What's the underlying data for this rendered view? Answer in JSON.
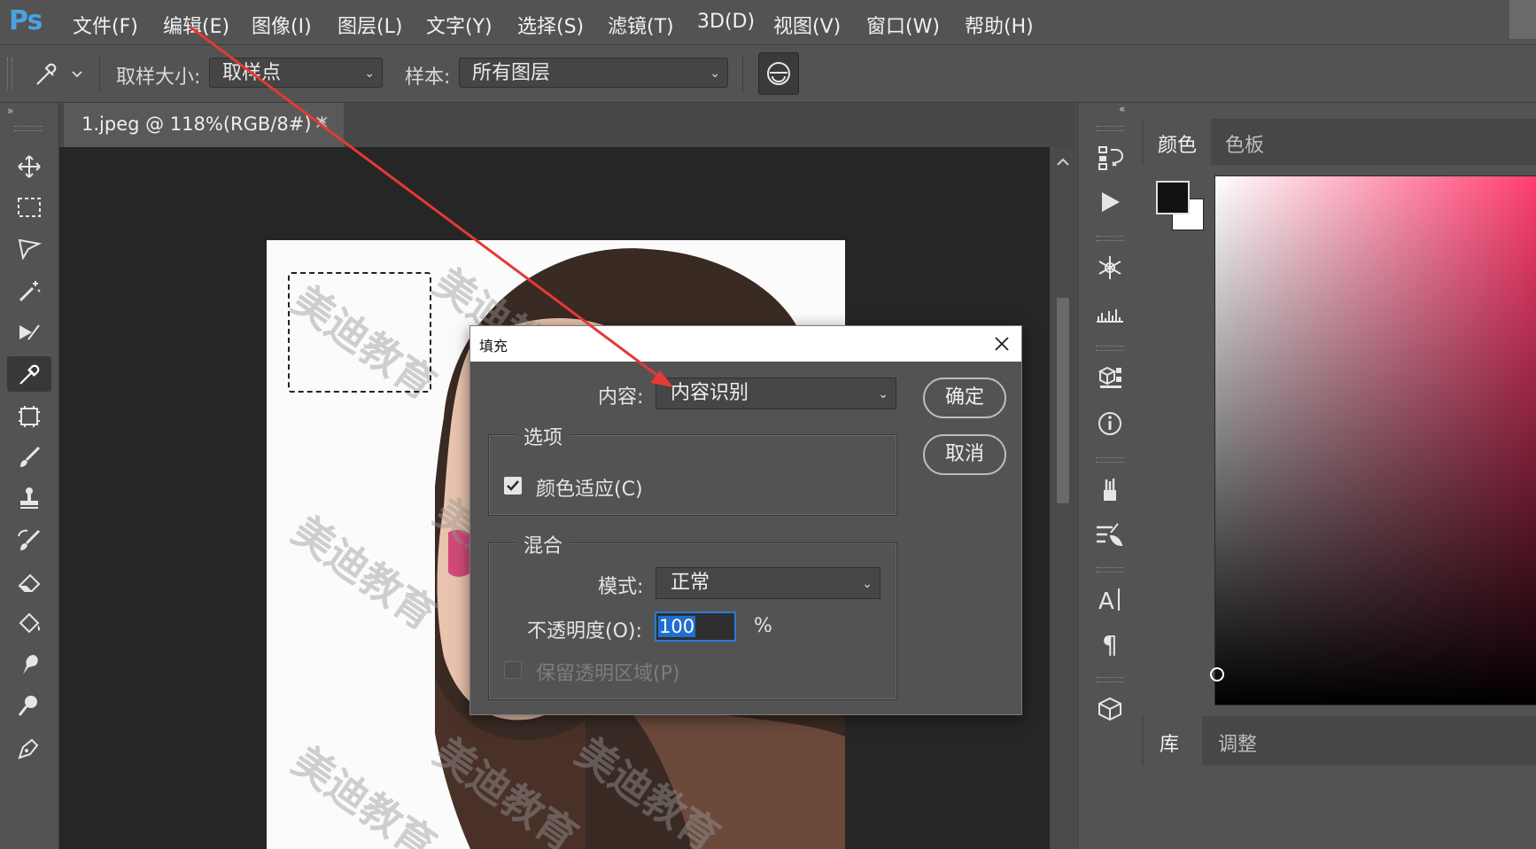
{
  "app": {
    "logo": "Ps",
    "menu": [
      "文件(F)",
      "编辑(E)",
      "图像(I)",
      "图层(L)",
      "文字(Y)",
      "选择(S)",
      "滤镜(T)",
      "3D(D)",
      "视图(V)",
      "窗口(W)",
      "帮助(H)"
    ]
  },
  "options_bar": {
    "sample_size_label": "取样大小:",
    "sample_size_value": "取样点",
    "sample_label": "样本:",
    "sample_value": "所有图层"
  },
  "document": {
    "tab_title": "1.jpeg @ 118%(RGB/8#) *",
    "watermark": "美迪教育"
  },
  "dialog": {
    "title": "填充",
    "content_label": "内容:",
    "content_value": "内容识别",
    "options_legend": "选项",
    "color_adaptation_label": "颜色适应(C)",
    "color_adaptation_checked": true,
    "blend_legend": "混合",
    "mode_label": "模式:",
    "mode_value": "正常",
    "opacity_label": "不透明度(O):",
    "opacity_value": "100",
    "opacity_unit": "%",
    "preserve_transparency_label": "保留透明区域(P)",
    "preserve_transparency_checked": false,
    "ok_label": "确定",
    "cancel_label": "取消"
  },
  "panels": {
    "color_tabs": [
      "颜色",
      "色板"
    ],
    "bottom_tabs": [
      "库",
      "调整"
    ]
  },
  "colors": {
    "accent_blue": "#4aa3df",
    "annotation_arrow": "#e53935",
    "foreground": "#111111",
    "background": "#ffffff"
  }
}
